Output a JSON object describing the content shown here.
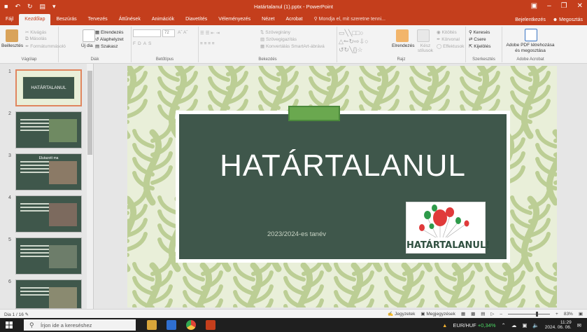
{
  "window": {
    "title": "Határtalanul (1).pptx - PowerPoint",
    "controls": [
      "▣",
      "–",
      "❐",
      "✕"
    ]
  },
  "quick_access": [
    "■",
    "↶",
    "↻",
    "▤",
    "▾"
  ],
  "tabs": [
    "Fájl",
    "Kezdőlap",
    "Beszúrás",
    "Tervezés",
    "Áttűnések",
    "Animációk",
    "Diavetítés",
    "Véleményezés",
    "Nézet",
    "Acrobat"
  ],
  "tell_me": "Mondja el, mit szeretne tenni...",
  "account": {
    "signin": "Bejelentkezés",
    "share": "Megosztás"
  },
  "ribbon": {
    "clipboard": {
      "paste": "Beillesztés",
      "cut": "Kivágás",
      "copy": "Másolás",
      "format_painter": "Formátummásoló",
      "label": "Vágólap"
    },
    "slides": {
      "new_slide": "Új dia",
      "layout": "Elrendezés",
      "reset": "Alaphelyzet",
      "section": "Szakasz",
      "label": "Diák"
    },
    "font": {
      "size": "72",
      "bold": "F",
      "italic": "D",
      "underline": "A",
      "strike": "S",
      "label": "Betűtípus"
    },
    "paragraph": {
      "text_direction": "Szövegirány",
      "align_text": "Szövegigazítás",
      "smartart": "Konvertálás SmartArt-ábrává",
      "label": "Bekezdés"
    },
    "drawing": {
      "arrange": "Elrendezés",
      "quick_styles": "Kész stílusok",
      "fill": "Kitöltés",
      "outline": "Körvonal",
      "effects": "Effektusok",
      "label": "Rajz"
    },
    "editing": {
      "find": "Keresés",
      "replace": "Csere",
      "select": "Kijelölés",
      "label": "Szerkesztés"
    },
    "acrobat": {
      "create_pdf": "Adobe PDF létrehozása és megosztása",
      "label": "Adobe Acrobat"
    }
  },
  "thumbnails": [
    {
      "num": "1",
      "title": "HATÁRTALANUL"
    },
    {
      "num": "2",
      "title": ""
    },
    {
      "num": "3",
      "title": "Elutazott ma"
    },
    {
      "num": "4",
      "title": ""
    },
    {
      "num": "5",
      "title": ""
    },
    {
      "num": "6",
      "title": ""
    }
  ],
  "slide": {
    "title": "HATÁRTALANUL",
    "subtitle": "2023/2024-es tanév",
    "logo_text": "HATÁRTALANUL!"
  },
  "statusbar": {
    "slide_count": "Dia 1 / 16",
    "notes": "Jegyzetek",
    "comments": "Megjegyzések",
    "zoom": "83%",
    "minus": "–",
    "plus": "+"
  },
  "taskbar": {
    "search_placeholder": "Írjon ide a kereséshez",
    "ticker": "EUR/HUF",
    "ticker_change": "+0,34%",
    "time": "11:29",
    "date": "2024. 06. 06."
  },
  "colors": {
    "accent": "#c43e1c",
    "slide_green": "#3f574b",
    "leaf": "#b5c98a",
    "tab_green": "#6aa84f"
  }
}
